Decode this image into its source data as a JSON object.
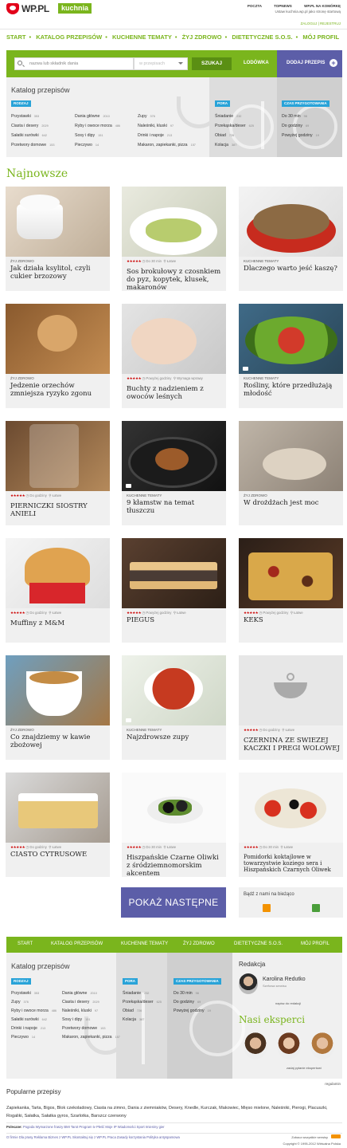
{
  "header": {
    "logo_text": "WP.PL",
    "logo_badge": "kuchnia",
    "top_links": [
      "POCZTA",
      "TOPNEWS",
      "WP.PL NA KOMÓRKĘ"
    ],
    "login_line": "Ustaw kuchnia.wp.pl jako stronę startową",
    "auth_links": "ZALOGUJ | REJESTRUJ"
  },
  "nav": {
    "items": [
      "START",
      "KATALOG PRZEPISÓW",
      "KUCHENNE TEMATY",
      "ŻYJ ZDROWO",
      "DIETETYCZNE S.O.S.",
      "MÓJ PROFIL"
    ]
  },
  "search": {
    "placeholder": "nazwa lub składnik dania",
    "scope": "w przepisach",
    "button": "SZUKAJ",
    "fridge": "LODÓWKA",
    "add_recipe": "DODAJ PRZEPIS"
  },
  "catalog": {
    "title": "Katalog przepisów",
    "tags": {
      "dishes": "RODZAJ",
      "time_of_day": "PORA",
      "prep_time": "CZAS PRZYGOTOWANIA"
    },
    "col1": [
      {
        "label": "Przystawki",
        "count": "353"
      },
      {
        "label": "Ciasta i desery",
        "count": "2029"
      },
      {
        "label": "Sałatki surówki",
        "count": "642"
      },
      {
        "label": "Przetwory domowe",
        "count": "153"
      }
    ],
    "col2": [
      {
        "label": "Dania główne",
        "count": "2010"
      },
      {
        "label": "Ryby i owoce morza",
        "count": "486"
      },
      {
        "label": "Sosy i dipy",
        "count": "151"
      },
      {
        "label": "Pieczywo",
        "count": "14"
      }
    ],
    "col3": [
      {
        "label": "Zupy",
        "count": "376"
      },
      {
        "label": "Naleśniki, kluski",
        "count": "97"
      },
      {
        "label": "Drinki i napoje",
        "count": "213"
      },
      {
        "label": "Makaron, zapiekanki, pizza",
        "count": "157"
      }
    ],
    "col4": [
      {
        "label": "Śniadanie",
        "count": "232"
      },
      {
        "label": "Przekąska/deser",
        "count": "625"
      },
      {
        "label": "Obiad",
        "count": "726"
      },
      {
        "label": "Kolacja",
        "count": "387"
      }
    ],
    "col5": [
      {
        "label": "Do 30 min",
        "count": "98"
      },
      {
        "label": "Do godziny",
        "count": "69"
      },
      {
        "label": "Powyżej godziny",
        "count": "19"
      }
    ]
  },
  "latest": {
    "title": "Najnowsze",
    "cards": [
      {
        "category": "ŻYJ ZDROWO",
        "stars": "",
        "time": "",
        "level": "",
        "title": "Jak działa ksylitol, czyli cukier brzozowy"
      },
      {
        "category": "",
        "stars": "★★★★★",
        "time": "Do 30 min",
        "level": "Łatwe",
        "title": "Sos brokułowy z czosnkiem do pyz, kopytek, klusek, makaronów"
      },
      {
        "category": "KUCHENNE TEMATY",
        "stars": "",
        "time": "",
        "level": "",
        "title": "Dlaczego warto jeść kaszę?"
      },
      {
        "category": "ŻYJ ZDROWO",
        "stars": "",
        "time": "",
        "level": "",
        "title": "Jedzenie orzechów zmniejsza ryzyko zgonu"
      },
      {
        "category": "",
        "stars": "★★★★★",
        "time": "Powyżej godziny",
        "level": "Wymaga wprawy",
        "title": "Buchty z nadzieniem z owoców leśnych"
      },
      {
        "category": "KUCHENNE TEMATY",
        "stars": "",
        "time": "",
        "level": "",
        "title": "Rośliny, które przedłużają młodość"
      },
      {
        "category": "",
        "stars": "★★★★★",
        "time": "Do godziny",
        "level": "Łatwe",
        "title": "PIERNICZKI SIOSTRY ANIELI"
      },
      {
        "category": "KUCHENNE TEMATY",
        "stars": "",
        "time": "",
        "level": "",
        "title": "9 kłamstw na temat tłuszczu"
      },
      {
        "category": "ŻYJ ZDROWO",
        "stars": "",
        "time": "",
        "level": "",
        "title": "W drożdżach jest moc"
      },
      {
        "category": "",
        "stars": "★★★★★",
        "time": "Do godziny",
        "level": "Łatwe",
        "title": "Muffiny z M&M"
      },
      {
        "category": "",
        "stars": "★★★★★",
        "time": "Powyżej godziny",
        "level": "Łatwe",
        "title": "PIEGUS"
      },
      {
        "category": "",
        "stars": "★★★★★",
        "time": "Powyżej godziny",
        "level": "Łatwe",
        "title": "KEKS"
      },
      {
        "category": "ŻYJ ZDROWO",
        "stars": "",
        "time": "",
        "level": "",
        "title": "Co znajdziemy w kawie zbożowej"
      },
      {
        "category": "KUCHENNE TEMATY",
        "stars": "",
        "time": "",
        "level": "",
        "title": "Najzdrowsze zupy"
      },
      {
        "category": "",
        "stars": "★★★★★",
        "time": "Do godziny",
        "level": "Łatwe",
        "title": "CZERNINA ZE SWIEZEJ KACZKI I PREGI WOLOWEJ"
      },
      {
        "category": "",
        "stars": "★★★★★",
        "time": "Do godziny",
        "level": "Łatwe",
        "title": "CIASTO CYTRUSOWE"
      },
      {
        "category": "",
        "stars": "★★★★★",
        "time": "Do 30 min",
        "level": "Łatwe",
        "title": "Hiszpańskie Czarne Oliwki z śródziemnomorskim akcentem"
      },
      {
        "category": "",
        "stars": "★★★★★",
        "time": "Do 30 min",
        "level": "Łatwe",
        "title": "Pomidorki koktajlowe w towarzystwie koziego sera i Hiszpańskich Czarnych Oliwek"
      }
    ]
  },
  "more_button": "POKAŻ NASTĘPNE",
  "follow": {
    "label": "Bądź z nami na bieżąco"
  },
  "footer": {
    "nav": [
      "START",
      "KATALOG PRZEPISÓW",
      "KUCHENNE TEMATY",
      "ŻYJ ZDROWO",
      "DIETETYCZNE S.O.S.",
      "MÓJ PROFIL"
    ],
    "catalog_title": "Katalog przepisów",
    "col1": [
      {
        "label": "Przystawki",
        "count": "353"
      },
      {
        "label": "Zupy",
        "count": "376"
      },
      {
        "label": "Ryby i owoce morza",
        "count": "486"
      },
      {
        "label": "Sałatki surówki",
        "count": "642"
      },
      {
        "label": "Drinki i napoje",
        "count": "213"
      },
      {
        "label": "Pieczywo",
        "count": "14"
      }
    ],
    "col2": [
      {
        "label": "Dania główne",
        "count": "2010"
      },
      {
        "label": "Ciasta i desery",
        "count": "2029"
      },
      {
        "label": "Naleśniki, kluski",
        "count": "97"
      },
      {
        "label": "Sosy i dipy",
        "count": "151"
      },
      {
        "label": "Przetwory domowe",
        "count": "153"
      },
      {
        "label": "Makaron, zapiekanki, pizza",
        "count": "157"
      }
    ],
    "col3": [
      {
        "label": "Śniadanie",
        "count": "232"
      },
      {
        "label": "Przekąska/deser",
        "count": "625"
      },
      {
        "label": "Obiad",
        "count": "726"
      },
      {
        "label": "Kolacja",
        "count": "387"
      }
    ],
    "col4": [
      {
        "label": "Do 30 min",
        "count": "98"
      },
      {
        "label": "Do godziny",
        "count": "69"
      },
      {
        "label": "Powyżej godziny",
        "count": "19"
      }
    ],
    "editor_title": "Redakcja",
    "editor_name": "Karolina Redutko",
    "editor_role": "Szefowa serwisu",
    "editor_ask": "napisz do redakcji",
    "experts_title": "Nasi eksperci",
    "experts_ask": "zadaj pytanie ekspertowi",
    "register_link": "regulamin"
  },
  "popular": {
    "title": "Popularne przepisy",
    "links": "Zapiekanka,  Tarta,  Bigos,  Blok czekoladowy,  Ciasta na zimno,  Dania z ziemniaków,  Desery,  Knedle,  Kurczak,  Makowiec,  Mięso mielone,  Naleśniki,  Pierogi,  Placuszki,  Rogaliki,  Sałatka,  Sałatka gyros,  Szarlotka,  Barszcz czerwony"
  },
  "partners": {
    "label": "Polecane:",
    "items": "Pogoda    Wymarzone fraszy    BMI    Tarot    Program tv    Płeść    Moje IP    Wiadomości    Sport    Imieniny gier"
  },
  "bottom": {
    "links": "O firmie    Dla prasy    Reklama    Biznes z WP.PL    Skontaktuj się z WP.PL    Praca    Zasady korzystania    Polityka antyspamowa",
    "see_all": "Zobacz wszystkie serwisy",
    "copyright": "Copyright © 1995-2012 Wirtualna Polska"
  }
}
